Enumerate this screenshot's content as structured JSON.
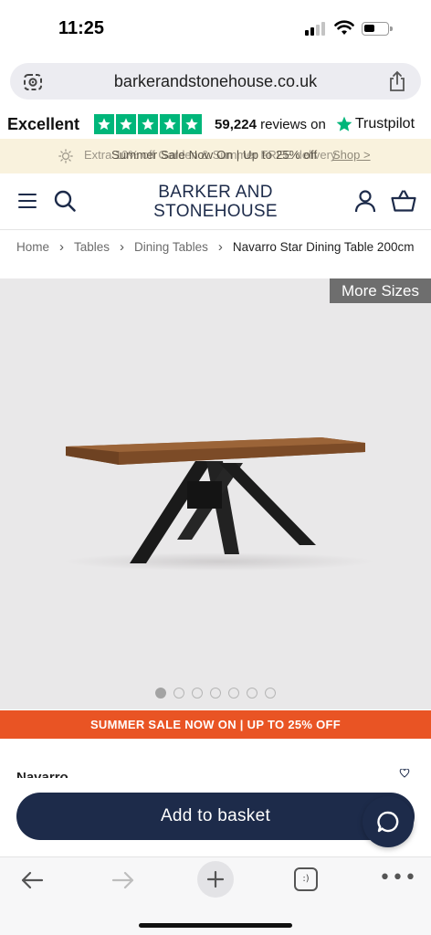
{
  "status_bar": {
    "time": "11:25"
  },
  "browser": {
    "url": "barkerandstonehouse.co.uk",
    "tabs_label": ":)"
  },
  "trustpilot": {
    "rating_word": "Excellent",
    "reviews_count": "59,224",
    "reviews_suffix": "reviews on",
    "brand": "Trustpilot",
    "star_color": "#00b67a"
  },
  "promo": {
    "text_faded": "Extra 10% off Garden & Summer FREE delivery",
    "text_main": "Summer Sale Now On | Up to 25% off",
    "link": "Shop >"
  },
  "header": {
    "logo_line1": "BARKER AND",
    "logo_line2": "STONEHOUSE",
    "brand_color": "#1d2b4a"
  },
  "breadcrumb": {
    "items": [
      "Home",
      "Tables",
      "Dining Tables"
    ],
    "current": "Navarro Star Dining Table 200cm"
  },
  "gallery": {
    "more_sizes": "More Sizes",
    "image_count": 7,
    "active_index": 0
  },
  "sale_banner": {
    "text": "SUMMER SALE NOW ON | UP TO 25% OFF",
    "color": "#e95424"
  },
  "product": {
    "name_peek": "Navarro"
  },
  "actions": {
    "add_to_basket": "Add to basket"
  }
}
